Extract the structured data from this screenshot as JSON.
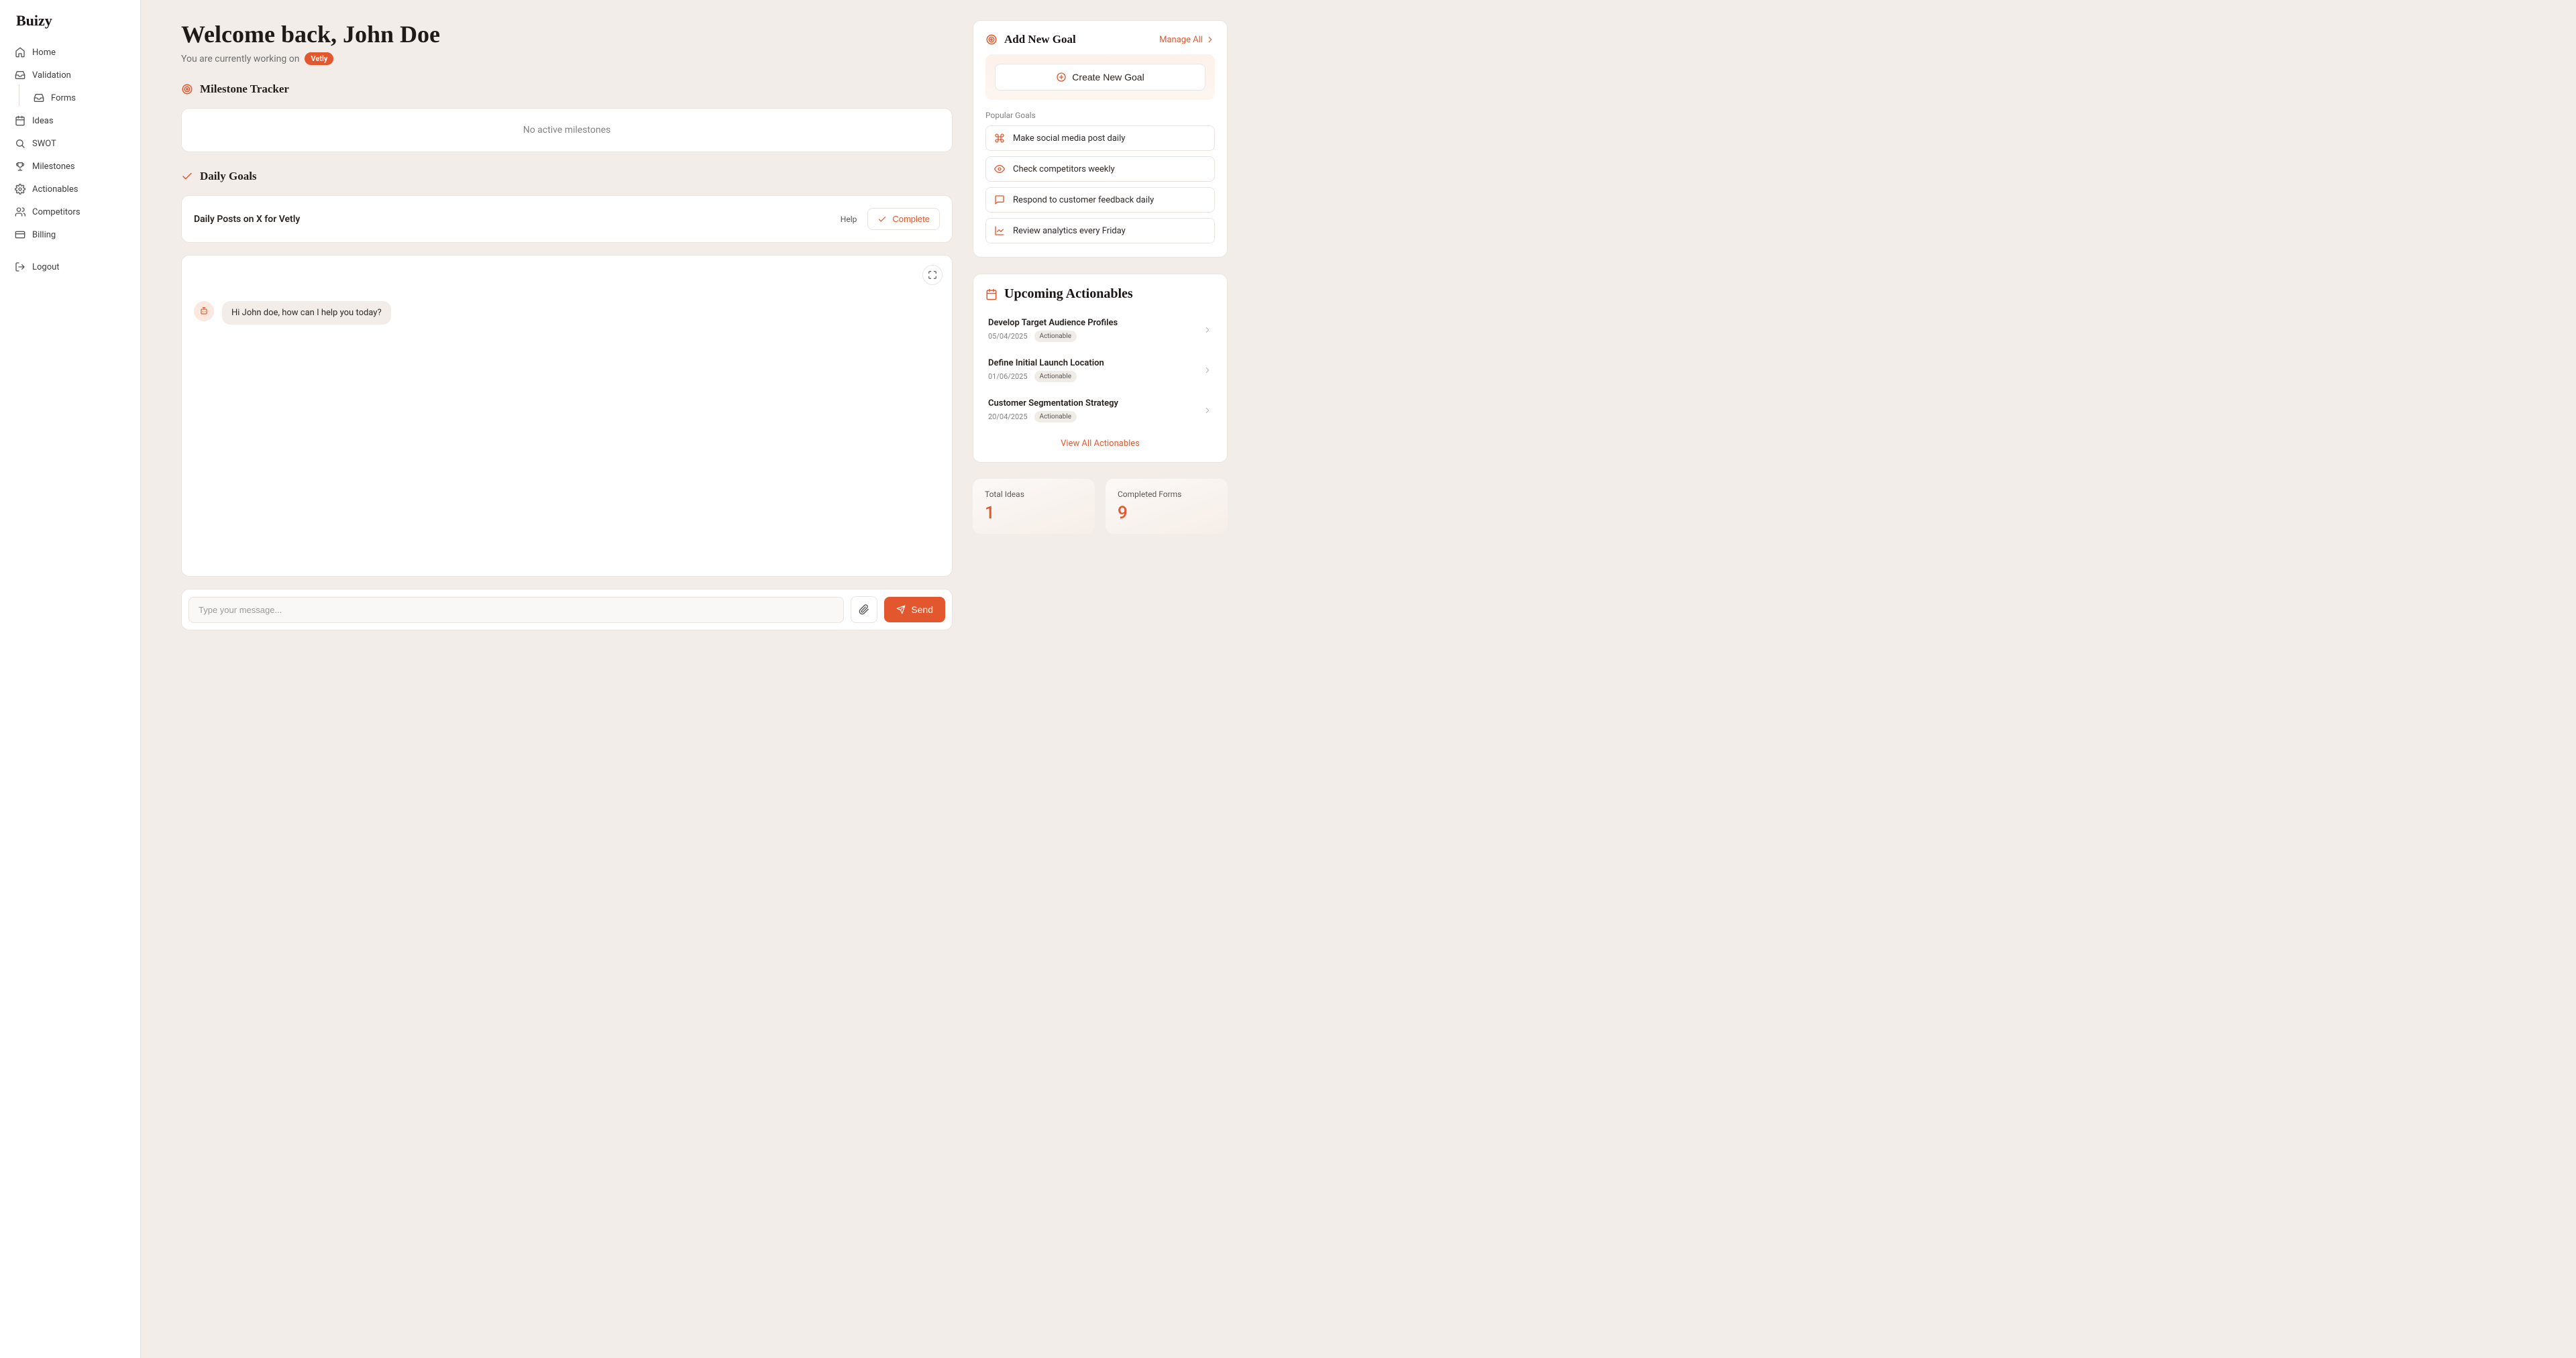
{
  "brand": "Buizy",
  "sidebar": {
    "items": [
      {
        "label": "Home",
        "icon": "home"
      },
      {
        "label": "Validation",
        "icon": "inbox"
      },
      {
        "label": "Forms",
        "icon": "inbox",
        "sub": true
      },
      {
        "label": "Ideas",
        "icon": "calendar"
      },
      {
        "label": "SWOT",
        "icon": "search"
      },
      {
        "label": "Milestones",
        "icon": "trophy"
      },
      {
        "label": "Actionables",
        "icon": "settings"
      },
      {
        "label": "Competitors",
        "icon": "users"
      },
      {
        "label": "Billing",
        "icon": "card"
      }
    ],
    "logout": "Logout"
  },
  "welcome": {
    "title": "Welcome back, John Doe",
    "subtitle_prefix": "You are currently working on",
    "project_tag": "Vetly"
  },
  "milestone": {
    "heading": "Milestone Tracker",
    "empty": "No active milestones"
  },
  "daily_goals": {
    "heading": "Daily Goals",
    "goal": "Daily Posts on X for Vetly",
    "help": "Help",
    "complete": "Complete"
  },
  "chat": {
    "greeting": "Hi John doe, how can I help you today?",
    "placeholder": "Type your message...",
    "send": "Send"
  },
  "add_goal": {
    "heading": "Add New Goal",
    "manage": "Manage All",
    "create": "Create New Goal",
    "popular_label": "Popular Goals",
    "popular": [
      {
        "icon": "command",
        "label": "Make social media post daily"
      },
      {
        "icon": "eye",
        "label": "Check competitors weekly"
      },
      {
        "icon": "message",
        "label": "Respond to customer feedback daily"
      },
      {
        "icon": "chart",
        "label": "Review analytics every Friday"
      }
    ]
  },
  "actionables": {
    "heading": "Upcoming Actionables",
    "items": [
      {
        "title": "Develop Target Audience Profiles",
        "date": "05/04/2025",
        "chip": "Actionable"
      },
      {
        "title": "Define Initial Launch Location",
        "date": "01/06/2025",
        "chip": "Actionable"
      },
      {
        "title": "Customer Segmentation Strategy",
        "date": "20/04/2025",
        "chip": "Actionable"
      }
    ],
    "view_all": "View All Actionables"
  },
  "stats": {
    "ideas_label": "Total Ideas",
    "ideas": "1",
    "forms_label": "Completed Forms",
    "forms": "9"
  }
}
